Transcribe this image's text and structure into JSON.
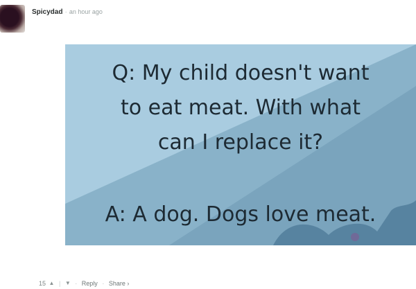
{
  "comment": {
    "author": "Spicydad",
    "separator": "·",
    "timestamp": "an hour ago"
  },
  "meme": {
    "question_lines": [
      "Q: My child doesn't want",
      "to eat meat. With what",
      "can I replace it?"
    ],
    "answer": "A: A dog. Dogs love meat.",
    "colors": {
      "light": "#a9cce0",
      "dark": "#6f9cb7",
      "text": "#1d2a33"
    }
  },
  "actions": {
    "vote_count": "15",
    "upvote_icon": "chevron-up-icon",
    "divider": "|",
    "downvote_icon": "chevron-down-icon",
    "dot": "·",
    "reply_label": "Reply",
    "share_label": "Share ›"
  }
}
